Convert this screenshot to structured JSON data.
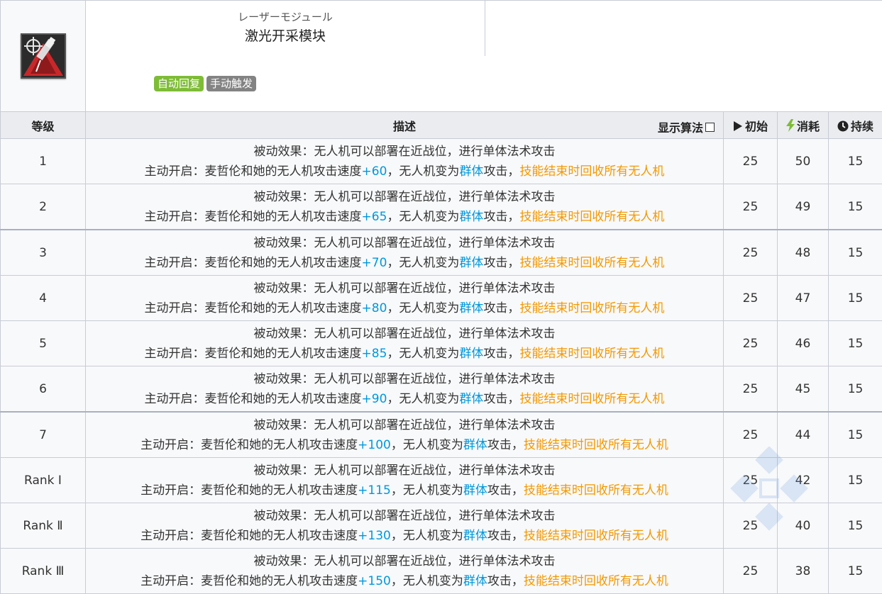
{
  "skill": {
    "name_jp": "レーザーモジュール",
    "name_cn": "激光开采模块",
    "tags": [
      "自动回复",
      "手动触发"
    ],
    "icon": "laser-drone-skill-icon"
  },
  "header": {
    "level": "等级",
    "description": "描述",
    "show_formula": "显示算法",
    "initial": "初始",
    "cost": "消耗",
    "duration": "持续"
  },
  "text": {
    "passive": "被动效果：无人机可以部署在近战位，进行单体法术攻击",
    "active_prefix": "主动开启：麦哲伦和她的无人机攻击速度",
    "drone_change": "，无人机变为",
    "group": "群体",
    "attack_suffix": "攻击，",
    "recall": "技能结束时回收所有无人机"
  },
  "rows": [
    {
      "level": "1",
      "speed": "+60",
      "initial": "25",
      "cost": "50",
      "duration": "15"
    },
    {
      "level": "2",
      "speed": "+65",
      "initial": "25",
      "cost": "49",
      "duration": "15"
    },
    {
      "level": "3",
      "speed": "+70",
      "initial": "25",
      "cost": "48",
      "duration": "15"
    },
    {
      "level": "4",
      "speed": "+80",
      "initial": "25",
      "cost": "47",
      "duration": "15"
    },
    {
      "level": "5",
      "speed": "+85",
      "initial": "25",
      "cost": "46",
      "duration": "15"
    },
    {
      "level": "6",
      "speed": "+90",
      "initial": "25",
      "cost": "45",
      "duration": "15"
    },
    {
      "level": "7",
      "speed": "+100",
      "initial": "25",
      "cost": "44",
      "duration": "15"
    },
    {
      "level": "Rank Ⅰ",
      "speed": "+115",
      "initial": "25",
      "cost": "42",
      "duration": "15"
    },
    {
      "level": "Rank Ⅱ",
      "speed": "+130",
      "initial": "25",
      "cost": "40",
      "duration": "15"
    },
    {
      "level": "Rank Ⅲ",
      "speed": "+150",
      "initial": "25",
      "cost": "38",
      "duration": "15"
    }
  ],
  "colors": {
    "accent_blue": "#0098dc",
    "accent_orange": "#f49800",
    "tag_green": "#7ebc36",
    "tag_gray": "#838383"
  }
}
